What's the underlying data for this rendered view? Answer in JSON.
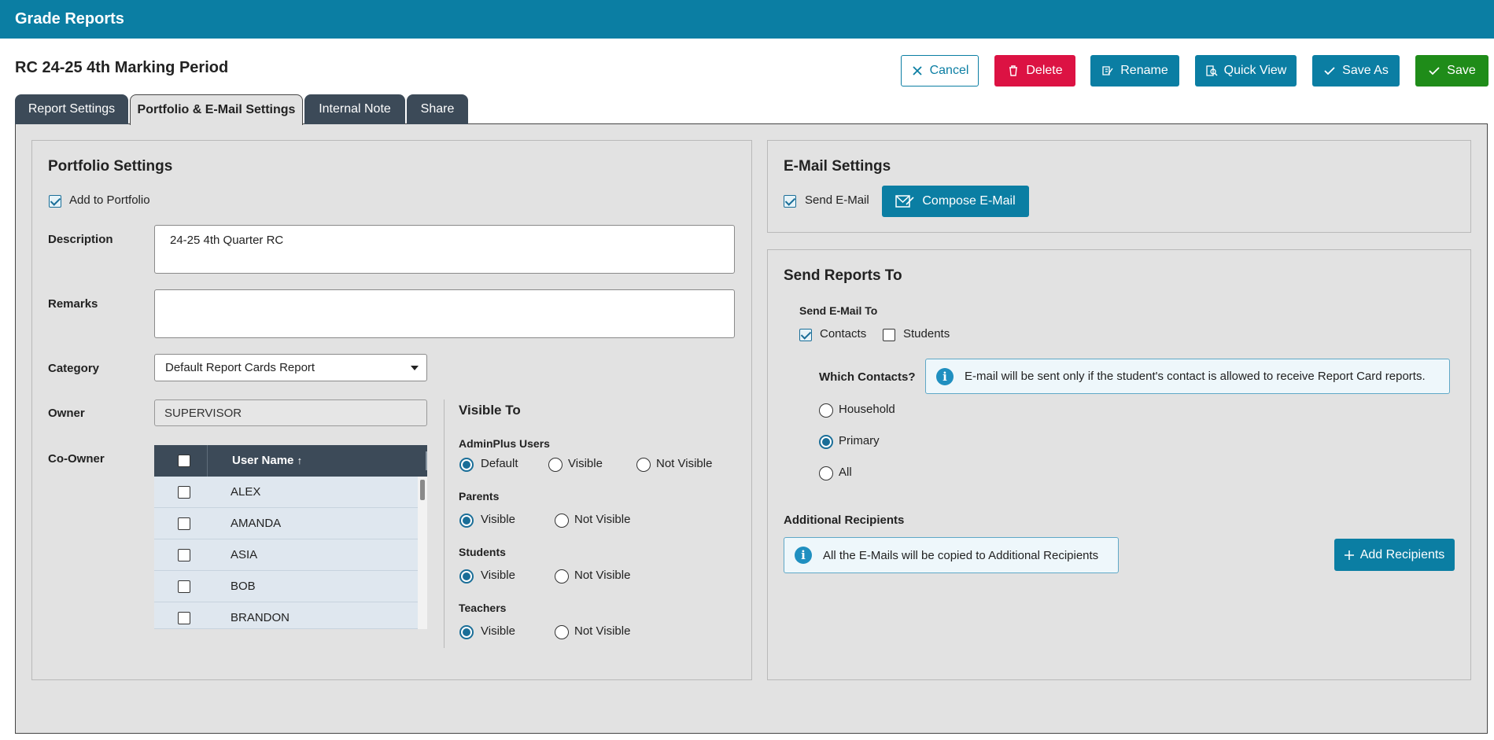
{
  "app": {
    "title": "Grade Reports"
  },
  "report": {
    "name": "RC 24-25 4th Marking Period"
  },
  "toolbar": {
    "cancel": "Cancel",
    "delete": "Delete",
    "rename": "Rename",
    "quick_view": "Quick View",
    "save_as": "Save As",
    "save": "Save"
  },
  "tabs": [
    {
      "label": "Report Settings",
      "active": false
    },
    {
      "label": "Portfolio & E-Mail Settings",
      "active": true
    },
    {
      "label": "Internal Note",
      "active": false
    },
    {
      "label": "Share",
      "active": false
    }
  ],
  "portfolio": {
    "heading": "Portfolio Settings",
    "add_to_portfolio": {
      "label": "Add to Portfolio",
      "checked": true
    },
    "description": {
      "label": "Description",
      "value": "24-25 4th Quarter RC"
    },
    "remarks": {
      "label": "Remarks",
      "value": ""
    },
    "category": {
      "label": "Category",
      "value": "Default Report Cards Report"
    },
    "owner": {
      "label": "Owner",
      "value": "SUPERVISOR"
    },
    "co_owner": {
      "label": "Co-Owner",
      "column": "User Name",
      "sort_glyph": "↑",
      "rows": [
        "ALEX",
        "AMANDA",
        "ASIA",
        "BOB",
        "BRANDON"
      ]
    },
    "visible_to": {
      "heading": "Visible To",
      "groups": [
        {
          "label": "AdminPlus Users",
          "options": [
            "Default",
            "Visible",
            "Not Visible"
          ],
          "selected": "Default"
        },
        {
          "label": "Parents",
          "options": [
            "Visible",
            "Not Visible"
          ],
          "selected": "Visible"
        },
        {
          "label": "Students",
          "options": [
            "Visible",
            "Not Visible"
          ],
          "selected": "Visible"
        },
        {
          "label": "Teachers",
          "options": [
            "Visible",
            "Not Visible"
          ],
          "selected": "Visible"
        }
      ]
    }
  },
  "email": {
    "heading": "E-Mail Settings",
    "send_email": {
      "label": "Send E-Mail",
      "checked": true
    },
    "compose": "Compose E-Mail"
  },
  "send_reports": {
    "heading": "Send Reports To",
    "send_email_to": "Send E-Mail To",
    "contacts": {
      "label": "Contacts",
      "checked": true
    },
    "students": {
      "label": "Students",
      "checked": false
    },
    "which_contacts": "Which Contacts?",
    "info": "E-mail will be sent only if the student's contact is allowed to receive Report Card reports.",
    "options": [
      "Household",
      "Primary",
      "All"
    ],
    "selected": "Primary",
    "additional_recipients": "Additional Recipients",
    "additional_info": "All the E-Mails will be copied to Additional Recipients",
    "add_recipients": "Add Recipients"
  },
  "colors": {
    "header": "#0b7ea3",
    "primary_button": "#0b7ea3",
    "delete_button": "#dc1243",
    "save_button": "#1f8c19",
    "tab_dark": "#3c4a58"
  }
}
